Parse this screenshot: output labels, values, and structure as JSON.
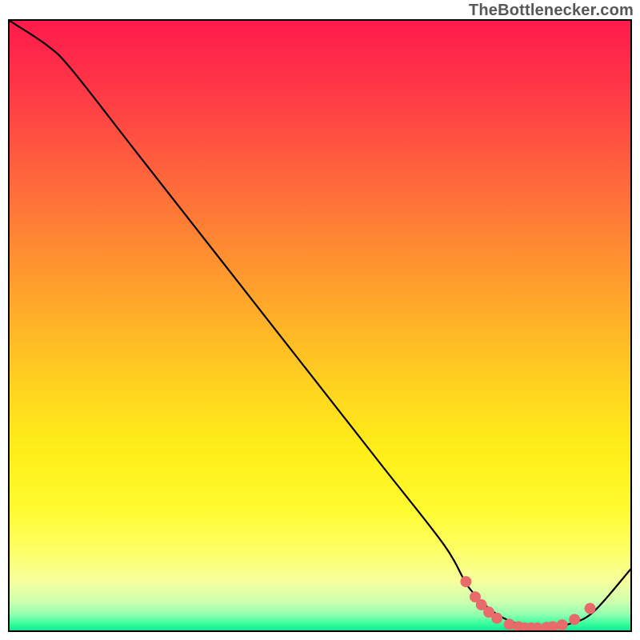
{
  "attribution": "TheBottlenecker.com",
  "chart_data": {
    "type": "line",
    "title": "",
    "xlabel": "",
    "ylabel": "",
    "xlim": [
      0,
      100
    ],
    "ylim": [
      0,
      100
    ],
    "series": [
      {
        "name": "curve",
        "x": [
          0,
          6,
          10,
          20,
          30,
          40,
          50,
          60,
          70,
          74,
          78,
          82,
          86,
          90,
          94,
          100
        ],
        "y": [
          100,
          96,
          92,
          79,
          66,
          53,
          40,
          27,
          14,
          7,
          3,
          1,
          0,
          1,
          3,
          10
        ]
      }
    ],
    "markers": [
      {
        "x": 73.5,
        "y": 8.0
      },
      {
        "x": 75.0,
        "y": 5.5
      },
      {
        "x": 76.0,
        "y": 4.2
      },
      {
        "x": 77.2,
        "y": 3.0
      },
      {
        "x": 78.5,
        "y": 2.0
      },
      {
        "x": 80.5,
        "y": 1.0
      },
      {
        "x": 82.0,
        "y": 0.6
      },
      {
        "x": 83.0,
        "y": 0.4
      },
      {
        "x": 84.0,
        "y": 0.4
      },
      {
        "x": 85.0,
        "y": 0.4
      },
      {
        "x": 86.5,
        "y": 0.5
      },
      {
        "x": 87.5,
        "y": 0.6
      },
      {
        "x": 89.0,
        "y": 0.9
      },
      {
        "x": 91.0,
        "y": 1.8
      },
      {
        "x": 93.5,
        "y": 3.6
      }
    ],
    "marker_color": "#e86a6a"
  }
}
